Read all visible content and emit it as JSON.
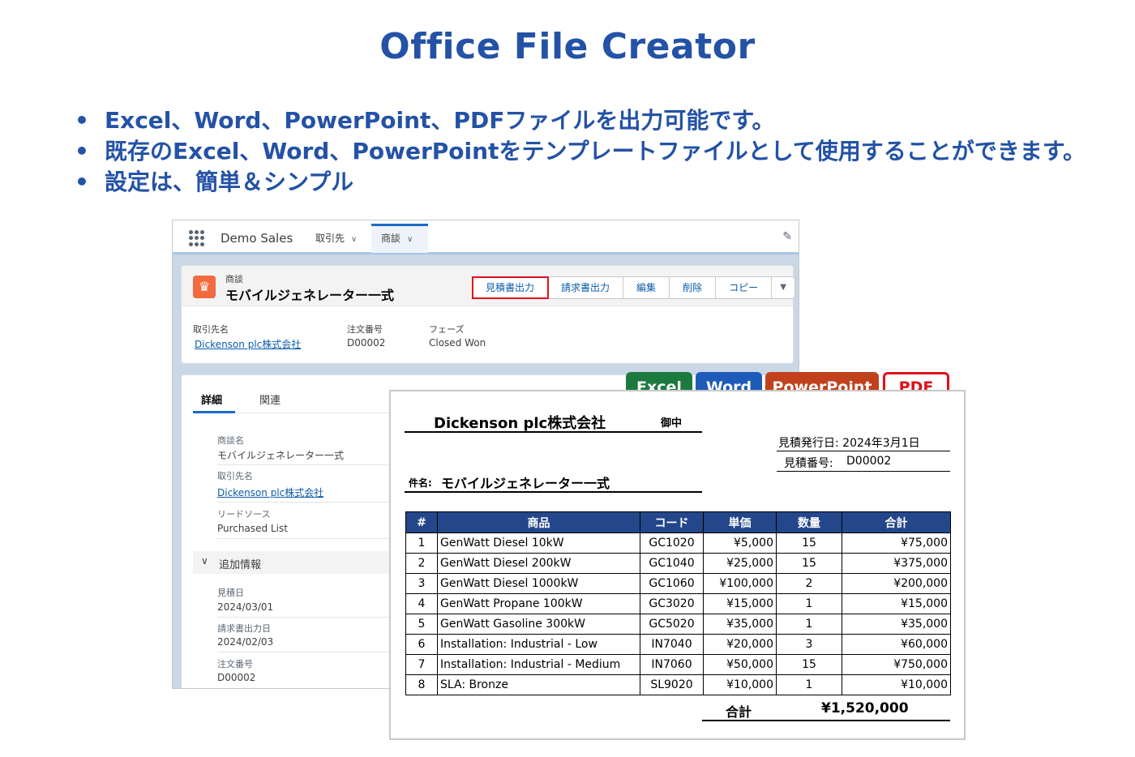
{
  "title": "Office File Creator",
  "bullets": [
    "Excel、Word、PowerPoint、PDFファイルを出力可能です。",
    "既存のExcel、Word、PowerPointをテンプレートファイルとして使用することができます。",
    "設定は、簡単＆シンプル"
  ],
  "bullet_mark": "•",
  "nav": {
    "app_name": "Demo Sales",
    "tabs": [
      "取引先",
      "商談"
    ],
    "chevron": "∨",
    "icons": [
      "app-launcher-icon",
      "chevron-down-icon",
      "pencil-icon"
    ]
  },
  "record": {
    "object_label": "商談",
    "name": "モバイルジェネレーター一式",
    "icon": "crown-icon",
    "actions": [
      "見積書出力",
      "請求書出力",
      "編集",
      "削除",
      "コピー"
    ],
    "highlighted_action": "見積書出力",
    "highlight_color": "#e0101a",
    "menu_glyph": "▼",
    "highlights": [
      {
        "label": "取引先名",
        "value": "Dickenson plc株式会社"
      },
      {
        "label": "注文番号",
        "value": "D00002"
      },
      {
        "label": "フェーズ",
        "value": "Closed Won"
      }
    ]
  },
  "detail": {
    "tabs": [
      "詳細",
      "関連"
    ],
    "fields": [
      {
        "label": "商談名",
        "value": "モバイルジェネレーター一式"
      },
      {
        "label": "取引先名",
        "value": "Dickenson plc株式会社"
      },
      {
        "label": "リードソース",
        "value": "Purchased List"
      }
    ],
    "section": "追加情報",
    "section_fields": [
      {
        "label": "見積日",
        "value": "2024/03/01"
      },
      {
        "label": "請求書出力日",
        "value": "2024/02/03"
      },
      {
        "label": "注文番号",
        "value": "D00002"
      }
    ]
  },
  "formats": [
    {
      "label": "Excel",
      "color": "#1d7a3f"
    },
    {
      "label": "Word",
      "color": "#1e5bb8"
    },
    {
      "label": "PowerPoint",
      "color": "#c2411d"
    },
    {
      "label": "PDF",
      "color": "#e0101a"
    }
  ],
  "document": {
    "company": "Dickenson plc株式会社",
    "honorific": "御中",
    "issue_date": "見積発行日: 2024年3月1日",
    "quote_no_label": "見積番号:",
    "quote_no": "D00002",
    "subject_label": "件名:",
    "subject": "モバイルジェネレーター一式",
    "header_color": "#24468a",
    "columns": [
      "#",
      "商品",
      "コード",
      "単価",
      "数量",
      "合計"
    ],
    "rows": [
      [
        "1",
        "GenWatt Diesel 10kW",
        "GC1020",
        "¥5,000",
        "15",
        "¥75,000"
      ],
      [
        "2",
        "GenWatt Diesel 200kW",
        "GC1040",
        "¥25,000",
        "15",
        "¥375,000"
      ],
      [
        "3",
        "GenWatt Diesel 1000kW",
        "GC1060",
        "¥100,000",
        "2",
        "¥200,000"
      ],
      [
        "4",
        "GenWatt Propane 100kW",
        "GC3020",
        "¥15,000",
        "1",
        "¥15,000"
      ],
      [
        "5",
        "GenWatt Gasoline 300kW",
        "GC5020",
        "¥35,000",
        "1",
        "¥35,000"
      ],
      [
        "6",
        "Installation: Industrial - Low",
        "IN7040",
        "¥20,000",
        "3",
        "¥60,000"
      ],
      [
        "7",
        "Installation: Industrial - Medium",
        "IN7060",
        "¥50,000",
        "15",
        "¥750,000"
      ],
      [
        "8",
        "SLA: Bronze",
        "SL9020",
        "¥10,000",
        "1",
        "¥10,000"
      ]
    ],
    "total_label": "合計",
    "total_value": "¥1,520,000"
  }
}
